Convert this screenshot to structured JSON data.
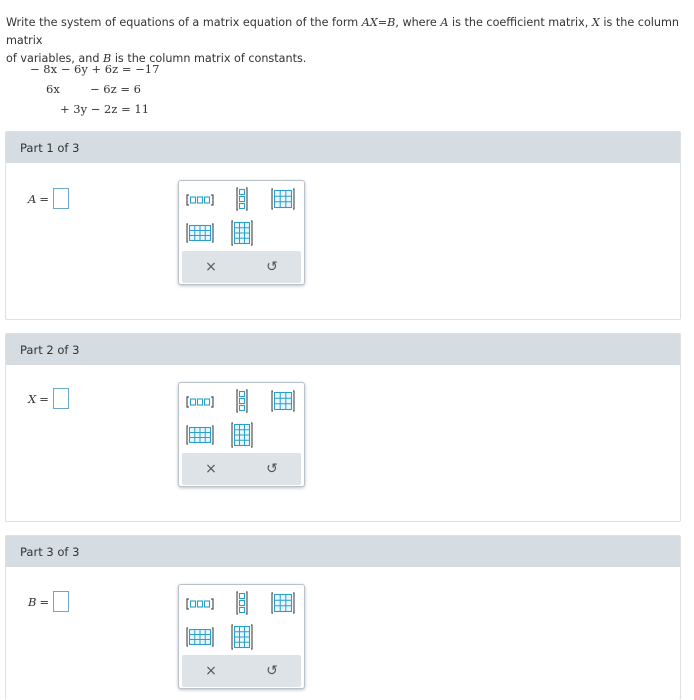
{
  "prompt": {
    "line1_a": "Write the system of equations of a matrix equation of the form ",
    "line1_math": "AX=B",
    "line1_b": ", where ",
    "line1_A": "A",
    "line1_c": " is the coefficient matrix, ",
    "line1_X": "X",
    "line1_d": " is the column matrix",
    "line2_a": "of variables, and ",
    "line2_B": "B",
    "line2_b": " is the column matrix of constants."
  },
  "system": {
    "eq1": "− 8x − 6y + 6z = −17",
    "eq2_a": "6x",
    "eq2_b": "− 6z = 6",
    "eq3": "+ 3y − 2z = 11"
  },
  "parts": [
    {
      "header": "Part 1 of 3",
      "var": "A",
      "eq": "="
    },
    {
      "header": "Part 2 of 3",
      "var": "X",
      "eq": "="
    },
    {
      "header": "Part 3 of 3",
      "var": "B",
      "eq": "="
    }
  ],
  "palette": {
    "clear_symbol": "×",
    "undo_symbol": "↺",
    "icons": [
      "row-matrix-icon",
      "column-matrix-icon",
      "matrix-3x3-icon",
      "matrix-wide-icon",
      "matrix-tall-icon"
    ]
  },
  "colors": {
    "accent": "#2aa0c8",
    "header_bg": "#d6dde2",
    "input_border": "#6ca7c9"
  }
}
